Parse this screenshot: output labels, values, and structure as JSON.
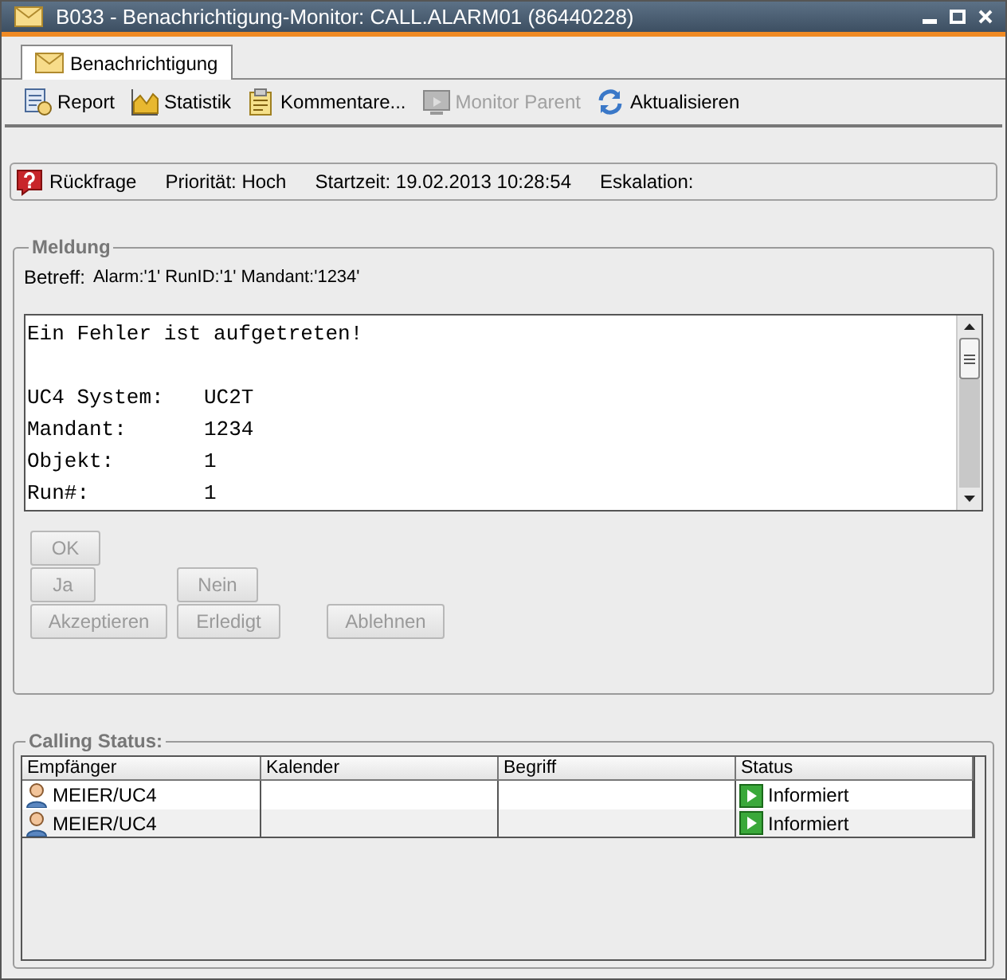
{
  "window": {
    "title": "B033 - Benachrichtigung-Monitor: CALL.ALARM01 (86440228)"
  },
  "tabs": [
    {
      "label": "Benachrichtigung",
      "selected": true
    }
  ],
  "toolbar": [
    {
      "kind": "report",
      "label": "Report",
      "disabled": false
    },
    {
      "kind": "chart",
      "label": "Statistik",
      "disabled": false
    },
    {
      "kind": "notes",
      "label": "Kommentare...",
      "disabled": false
    },
    {
      "kind": "monitor",
      "label": "Monitor Parent",
      "disabled": true
    },
    {
      "kind": "refresh",
      "label": "Aktualisieren",
      "disabled": false
    }
  ],
  "info": {
    "type": "Rückfrage",
    "priority": "Priorität: Hoch",
    "start": "Startzeit: 19.02.2013 10:28:54",
    "escalation": "Eskalation:"
  },
  "message": {
    "title": "Meldung",
    "subject_label": "Betreff:",
    "subject": "Alarm:'1' RunID:'1' Mandant:'1234'",
    "lines": [
      {
        "kind": "heading",
        "key": "Ein Fehler ist aufgetreten!"
      },
      {
        "kind": "field",
        "key": "UC4 System:",
        "value": "UC2T"
      },
      {
        "kind": "field",
        "key": "Mandant:",
        "value": "1234"
      },
      {
        "kind": "field",
        "key": "Objekt:",
        "value": "1"
      },
      {
        "kind": "field",
        "key": "Run#:",
        "value": "1"
      }
    ],
    "buttons": [
      [
        {
          "label": "OK",
          "disabled": true
        }
      ],
      [
        {
          "label": "Ja",
          "disabled": true
        },
        {
          "label": "Nein",
          "disabled": true
        }
      ],
      [
        {
          "label": "Akzeptieren",
          "disabled": true
        },
        {
          "label": "Erledigt",
          "disabled": true
        },
        {
          "label": "Ablehnen",
          "disabled": true
        }
      ]
    ]
  },
  "calling_status": {
    "title": "Calling Status:",
    "columns": [
      "Empfänger",
      "Kalender",
      "Begriff",
      "Status"
    ],
    "rows": [
      {
        "recipient": "MEIER/UC4",
        "status": "Informiert"
      },
      {
        "recipient": "MEIER/UC4",
        "status": "Informiert"
      }
    ]
  }
}
